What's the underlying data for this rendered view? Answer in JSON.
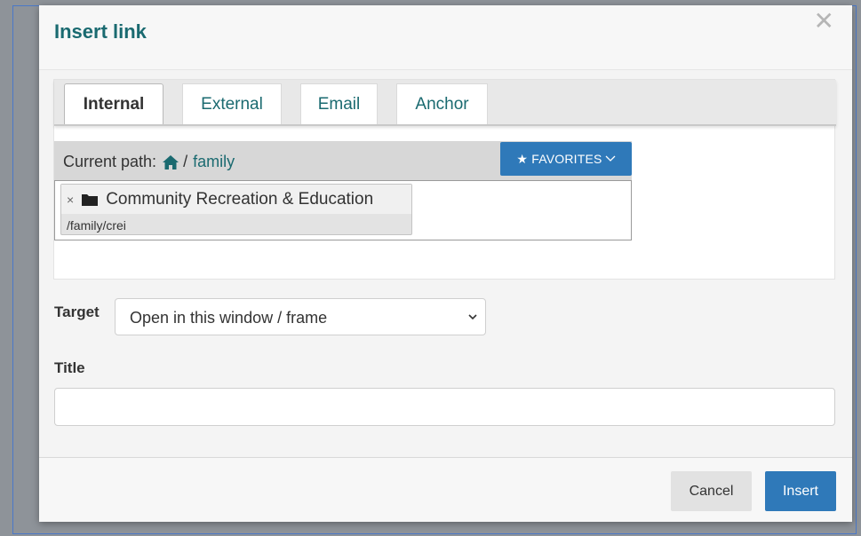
{
  "dialog": {
    "title": "Insert link",
    "close_symbol": "✕"
  },
  "tabs": [
    {
      "label": "Internal",
      "active": true
    },
    {
      "label": "External",
      "active": false
    },
    {
      "label": "Email",
      "active": false
    },
    {
      "label": "Anchor",
      "active": false
    }
  ],
  "path_bar": {
    "label": "Current path:",
    "separator": "/",
    "current": "family",
    "favorites_label": "★ FAVORITES"
  },
  "results": [
    {
      "remove_symbol": "×",
      "name": "Community Recreation & Education",
      "path": "/family/crei"
    }
  ],
  "target": {
    "label": "Target",
    "selected": "Open in this window / frame"
  },
  "title_field": {
    "label": "Title",
    "value": ""
  },
  "footer": {
    "cancel_label": "Cancel",
    "insert_label": "Insert"
  },
  "colors": {
    "accent_teal": "#1a6a70",
    "primary_blue": "#2f79b9"
  },
  "icons": {
    "home": "home-icon",
    "folder": "folder-icon",
    "chevron": "chevron-down-icon",
    "close": "close-icon"
  }
}
